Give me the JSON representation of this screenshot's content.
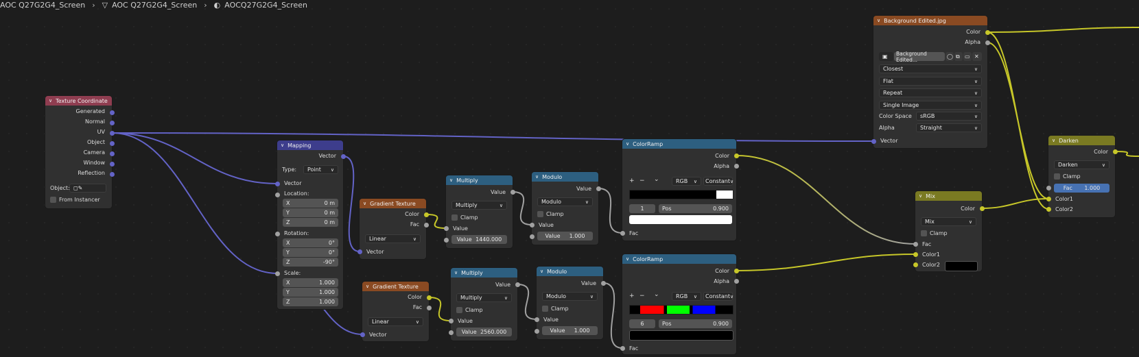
{
  "breadcrumb": [
    "AOC Q27G2G4_Screen",
    "AOC Q27G2G4_Screen",
    "AOCQ27G2G4_Screen"
  ],
  "colors": {
    "texture_header": "#8f3d50",
    "vector_header": "#3d3d8c",
    "tex_header": "#8a4a22",
    "converter_header": "#2d5f80",
    "color_header": "#7a7a22",
    "socket_color": "#c7c729",
    "socket_float": "#a1a1a1",
    "socket_vector": "#6363c7",
    "wire_vector": "#6363c7",
    "wire_color": "#c7c729",
    "wire_float": "#a1a1a1"
  },
  "tex_coord": {
    "title": "Texture Coordinate",
    "outputs": [
      "Generated",
      "Normal",
      "UV",
      "Object",
      "Camera",
      "Window",
      "Reflection"
    ],
    "object_label": "Object:",
    "from_instancer": "From Instancer"
  },
  "mapping": {
    "title": "Mapping",
    "vector_out": "Vector",
    "type_label": "Type:",
    "type_value": "Point",
    "vector_in": "Vector",
    "location_label": "Location:",
    "rotation_label": "Rotation:",
    "scale_label": "Scale:",
    "location": [
      {
        "axis": "X",
        "value": "0 m"
      },
      {
        "axis": "Y",
        "value": "0 m"
      },
      {
        "axis": "Z",
        "value": "0 m"
      }
    ],
    "rotation": [
      {
        "axis": "X",
        "value": "0°"
      },
      {
        "axis": "Y",
        "value": "0°"
      },
      {
        "axis": "Z",
        "value": "-90°"
      }
    ],
    "scale": [
      {
        "axis": "X",
        "value": "1.000"
      },
      {
        "axis": "Y",
        "value": "1.000"
      },
      {
        "axis": "Z",
        "value": "1.000"
      }
    ]
  },
  "grad1": {
    "title": "Gradient Texture",
    "color": "Color",
    "fac": "Fac",
    "mode": "Linear",
    "vector": "Vector"
  },
  "grad2": {
    "title": "Gradient Texture",
    "color": "Color",
    "fac": "Fac",
    "mode": "Linear",
    "vector": "Vector"
  },
  "mult1": {
    "title": "Multiply",
    "value_out": "Value",
    "op": "Multiply",
    "clamp": "Clamp",
    "value_in": "Value",
    "value_field_label": "Value",
    "value_field": "1440.000"
  },
  "mult2": {
    "title": "Multiply",
    "value_out": "Value",
    "op": "Multiply",
    "clamp": "Clamp",
    "value_in": "Value",
    "value_field_label": "Value",
    "value_field": "2560.000"
  },
  "mod1": {
    "title": "Modulo",
    "value_out": "Value",
    "op": "Modulo",
    "clamp": "Clamp",
    "value_in": "Value",
    "value_field_label": "Value",
    "value_field": "1.000"
  },
  "mod2": {
    "title": "Modulo",
    "value_out": "Value",
    "op": "Modulo",
    "clamp": "Clamp",
    "value_in": "Value",
    "value_field_label": "Value",
    "value_field": "1.000"
  },
  "ramp1": {
    "title": "ColorRamp",
    "color": "Color",
    "alpha": "Alpha",
    "plus": "+",
    "minus": "−",
    "chev": "⌄",
    "mode": "RGB",
    "interp": "Constant",
    "index": "1",
    "pos_label": "Pos",
    "pos": "0.900",
    "fac": "Fac",
    "swatch": "#ffffff"
  },
  "ramp2": {
    "title": "ColorRamp",
    "color": "Color",
    "alpha": "Alpha",
    "plus": "+",
    "minus": "−",
    "chev": "⌄",
    "mode": "RGB",
    "interp": "Constant",
    "index": "6",
    "pos_label": "Pos",
    "pos": "0.900",
    "fac": "Fac",
    "swatch": "#000000"
  },
  "bg": {
    "title": "Background Edited.jpg",
    "color": "Color",
    "alpha": "Alpha",
    "image_name": "Background Edited...",
    "interpolation": "Closest",
    "projection": "Flat",
    "extension": "Repeat",
    "source": "Single Image",
    "colorspace_label": "Color Space",
    "colorspace": "sRGB",
    "alpha_label": "Alpha",
    "alpha_mode": "Straight",
    "vector": "Vector"
  },
  "mix": {
    "title": "Mix",
    "color": "Color",
    "blend": "Mix",
    "clamp": "Clamp",
    "fac": "Fac",
    "color1": "Color1",
    "color2": "Color2",
    "color2_swatch": "#000000"
  },
  "darken": {
    "title": "Darken",
    "color": "Color",
    "blend": "Darken",
    "clamp": "Clamp",
    "fac_label": "Fac",
    "fac_value": "1.000",
    "color1": "Color1",
    "color2": "Color2"
  }
}
